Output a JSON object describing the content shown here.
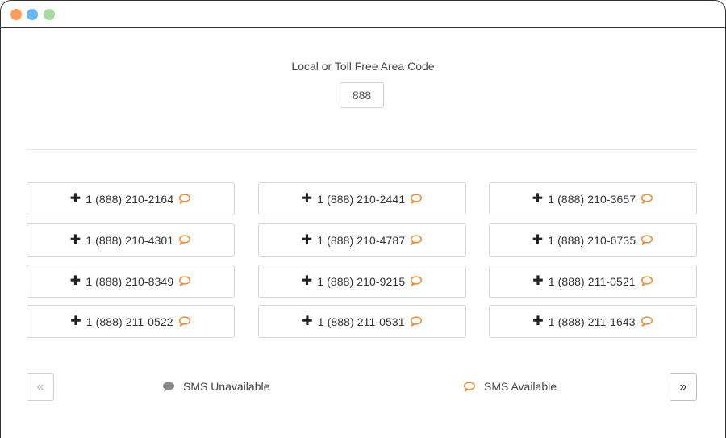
{
  "colors": {
    "dot_red": "#fe9e5b",
    "dot_yellow": "#69b5f1",
    "dot_green": "#a8dba0",
    "sms_available": "#f08a33",
    "sms_unavailable": "#8a8a8a"
  },
  "area": {
    "label": "Local or Toll Free Area Code",
    "value": "888"
  },
  "numbers": [
    {
      "label": "1 (888) 210-2164",
      "sms": true
    },
    {
      "label": "1 (888) 210-2441",
      "sms": true
    },
    {
      "label": "1 (888) 210-3657",
      "sms": true
    },
    {
      "label": "1 (888) 210-4301",
      "sms": true
    },
    {
      "label": "1 (888) 210-4787",
      "sms": true
    },
    {
      "label": "1 (888) 210-6735",
      "sms": true
    },
    {
      "label": "1 (888) 210-8349",
      "sms": true
    },
    {
      "label": "1 (888) 210-9215",
      "sms": true
    },
    {
      "label": "1 (888) 211-0521",
      "sms": true
    },
    {
      "label": "1 (888) 211-0522",
      "sms": true
    },
    {
      "label": "1 (888) 211-0531",
      "sms": true
    },
    {
      "label": "1 (888) 211-1643",
      "sms": true
    }
  ],
  "pagination": {
    "prev_label": "«",
    "next_label": "»"
  },
  "legend": {
    "unavailable_label": "SMS Unavailable",
    "available_label": "SMS Available"
  },
  "icons": {
    "add": "plus-icon",
    "sms_available": "speech-bubble-outline-icon",
    "sms_unavailable": "speech-bubble-filled-icon"
  }
}
